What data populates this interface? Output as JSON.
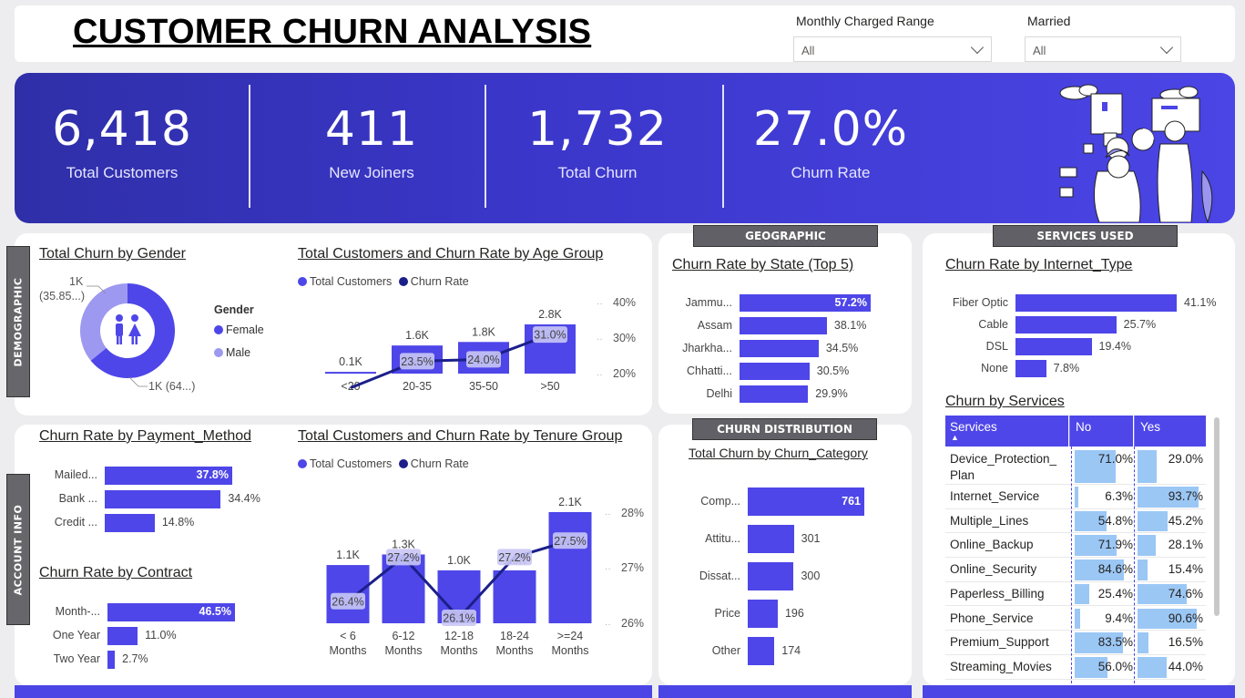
{
  "header": {
    "title": "CUSTOMER CHURN ANALYSIS",
    "slicers": [
      {
        "label": "Monthly Charged Range",
        "value": "All"
      },
      {
        "label": "Married",
        "value": "All"
      }
    ]
  },
  "kpis": [
    {
      "value": "6,418",
      "label": "Total Customers"
    },
    {
      "value": "411",
      "label": "New Joiners"
    },
    {
      "value": "1,732",
      "label": "Total Churn"
    },
    {
      "value": "27.0%",
      "label": "Churn Rate"
    }
  ],
  "sections": {
    "demographic": "DEMOGRAPHIC",
    "account_info": "ACCOUNT INFO",
    "geographic": "GEOGRAPHIC",
    "services_used": "SERVICES USED",
    "churn_distribution": "CHURN DISTRIBUTION"
  },
  "colors": {
    "accent": "#4e46e8",
    "line": "#1b1f8a",
    "kpi_band": "#3a36c8",
    "light_bar": "#9bc7f5"
  },
  "gender": {
    "title": "Total Churn by Gender",
    "legend_title": "Gender",
    "female_label": "Female",
    "male_label": "Male",
    "male_data_label": "1K",
    "male_data_label_pct": "(35.85...)",
    "female_data_label": "1K (64...)",
    "chart_data": {
      "type": "pie",
      "categories": [
        "Female",
        "Male"
      ],
      "values": [
        64.15,
        35.85
      ]
    }
  },
  "age": {
    "title": "Total Customers and Churn Rate by Age Group",
    "legend": [
      "Total Customers",
      "Churn Rate"
    ],
    "axis": [
      "40%",
      "30%",
      "20%"
    ],
    "chart_data": {
      "type": "bar",
      "categories": [
        "<20",
        "20-35",
        "35-50",
        ">50"
      ],
      "series": [
        {
          "name": "Total Customers",
          "values": [
            0.1,
            1.6,
            1.8,
            2.8
          ],
          "labels": [
            "0.1K",
            "1.6K",
            "1.8K",
            "2.8K"
          ]
        },
        {
          "name": "Churn Rate",
          "values": [
            16,
            23.5,
            24.0,
            31.0
          ],
          "labels": [
            "",
            "23.5%",
            "24.0%",
            "31.0%"
          ]
        }
      ],
      "ylim": [
        0,
        3
      ]
    }
  },
  "payment": {
    "title": "Churn Rate by Payment_Method",
    "chart_data": {
      "type": "bar",
      "categories": [
        "Mailed...",
        "Bank ...",
        "Credit ..."
      ],
      "values": [
        37.8,
        34.4,
        14.8
      ],
      "labels": [
        "37.8%",
        "34.4%",
        "14.8%"
      ]
    }
  },
  "contract": {
    "title": "Churn Rate by Contract",
    "chart_data": {
      "type": "bar",
      "categories": [
        "Month-...",
        "One Year",
        "Two Year"
      ],
      "values": [
        46.5,
        11.0,
        2.7
      ],
      "labels": [
        "46.5%",
        "11.0%",
        "2.7%"
      ]
    }
  },
  "tenure": {
    "title": "Total Customers and Churn Rate by Tenure Group",
    "legend": [
      "Total Customers",
      "Churn Rate"
    ],
    "axis": [
      "28%",
      "27%",
      "26%"
    ],
    "chart_data": {
      "type": "bar",
      "categories": [
        "< 6 Months",
        "6-12 Months",
        "12-18 Months",
        "18-24 Months",
        ">=24 Months"
      ],
      "cat_line1": [
        "< 6",
        "6-12",
        "12-18",
        "18-24",
        ">=24"
      ],
      "cat_line2": [
        "Months",
        "Months",
        "Months",
        "Months",
        "Months"
      ],
      "series": [
        {
          "name": "Total Customers",
          "values": [
            1.1,
            1.3,
            1.0,
            1.0,
            2.1
          ],
          "labels": [
            "1.1K",
            "1.3K",
            "1.0K",
            "1.0K",
            "2.1K"
          ]
        },
        {
          "name": "Churn Rate",
          "values": [
            26.4,
            27.2,
            26.1,
            27.2,
            27.5
          ],
          "labels": [
            "26.4%",
            "27.2%",
            "26.1%",
            "27.2%",
            "27.5%"
          ]
        }
      ]
    }
  },
  "state": {
    "title": "Churn Rate by State (Top 5)",
    "chart_data": {
      "type": "bar",
      "categories": [
        "Jammu...",
        "Assam",
        "Jharkha...",
        "Chhatti...",
        "Delhi"
      ],
      "values": [
        57.2,
        38.1,
        34.5,
        30.5,
        29.9
      ],
      "labels": [
        "57.2%",
        "38.1%",
        "34.5%",
        "30.5%",
        "29.9%"
      ]
    }
  },
  "category": {
    "title": "Total Churn by Churn_Category",
    "chart_data": {
      "type": "bar",
      "categories": [
        "Comp...",
        "Attitu...",
        "Dissat...",
        "Price",
        "Other"
      ],
      "values": [
        761,
        301,
        300,
        196,
        174
      ],
      "labels": [
        "761",
        "301",
        "300",
        "196",
        "174"
      ]
    }
  },
  "internet": {
    "title": "Churn Rate by Internet_Type",
    "chart_data": {
      "type": "bar",
      "categories": [
        "Fiber Optic",
        "Cable",
        "DSL",
        "None"
      ],
      "values": [
        41.1,
        25.7,
        19.4,
        7.8
      ],
      "labels": [
        "41.1%",
        "25.7%",
        "19.4%",
        "7.8%"
      ]
    }
  },
  "services": {
    "title": "Churn by Services",
    "columns": [
      "Services",
      "No",
      "Yes"
    ],
    "chart_data": {
      "type": "table",
      "rows": [
        {
          "name": "Device_Protection_ Plan",
          "no": "71.0%",
          "yes": "29.0%",
          "no_v": 71.0,
          "yes_v": 29.0
        },
        {
          "name": "Internet_Service",
          "no": "6.3%",
          "yes": "93.7%",
          "no_v": 6.3,
          "yes_v": 93.7
        },
        {
          "name": "Multiple_Lines",
          "no": "54.8%",
          "yes": "45.2%",
          "no_v": 54.8,
          "yes_v": 45.2
        },
        {
          "name": "Online_Backup",
          "no": "71.9%",
          "yes": "28.1%",
          "no_v": 71.9,
          "yes_v": 28.1
        },
        {
          "name": "Online_Security",
          "no": "84.6%",
          "yes": "15.4%",
          "no_v": 84.6,
          "yes_v": 15.4
        },
        {
          "name": "Paperless_Billing",
          "no": "25.4%",
          "yes": "74.6%",
          "no_v": 25.4,
          "yes_v": 74.6
        },
        {
          "name": "Phone_Service",
          "no": "9.4%",
          "yes": "90.6%",
          "no_v": 9.4,
          "yes_v": 90.6
        },
        {
          "name": "Premium_Support",
          "no": "83.5%",
          "yes": "16.5%",
          "no_v": 83.5,
          "yes_v": 16.5
        },
        {
          "name": "Streaming_Movies",
          "no": "56.0%",
          "yes": "44.0%",
          "no_v": 56.0,
          "yes_v": 44.0
        }
      ]
    }
  }
}
